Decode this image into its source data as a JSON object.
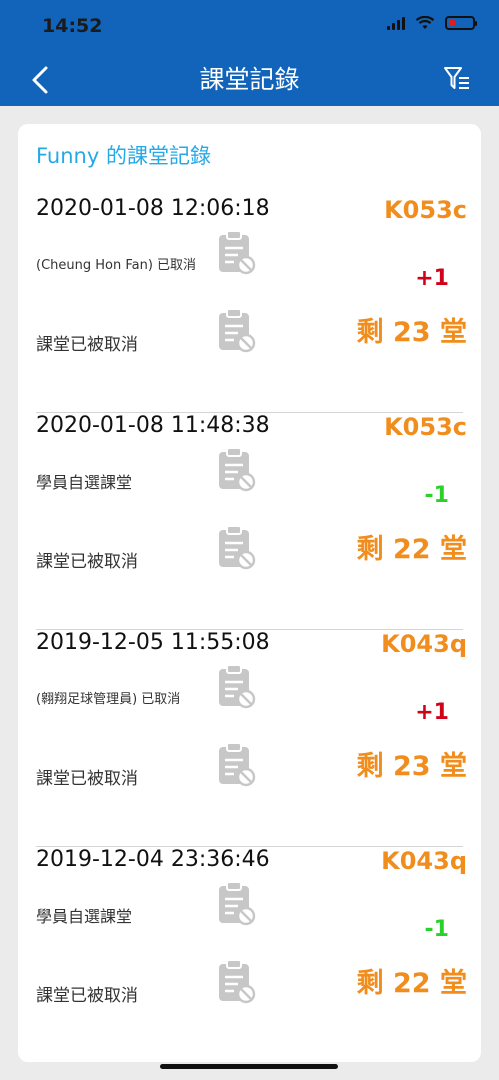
{
  "status_bar": {
    "time": "14:52"
  },
  "header": {
    "title": "課堂記錄"
  },
  "card": {
    "title": "Funny 的課堂記錄"
  },
  "records": [
    {
      "time": "2020-01-08 12:06:18",
      "code": "K053c",
      "desc": "(Cheung Hon Fan) 已取消",
      "change": "+1",
      "status": "課堂已被取消",
      "remaining": "剩 23 堂",
      "change_color": "#d0021b"
    },
    {
      "time": "2020-01-08 11:48:38",
      "code": "K053c",
      "desc": "學員自選課堂",
      "change": "-1",
      "status": "課堂已被取消",
      "remaining": "剩 22 堂",
      "change_color": "#2bd12b"
    },
    {
      "time": "2019-12-05 11:55:08",
      "code": "K043q",
      "desc": "(翱翔足球管理員) 已取消",
      "change": "+1",
      "status": "課堂已被取消",
      "remaining": "剩 23 堂",
      "change_color": "#d0021b"
    },
    {
      "time": "2019-12-04 23:36:46",
      "code": "K043q",
      "desc": "學員自選課堂",
      "change": "-1",
      "status": "課堂已被取消",
      "remaining": "剩 22 堂",
      "change_color": "#2bd12b"
    }
  ],
  "colors": {
    "header_bg": "#1164b9",
    "accent_orange": "#f08d1d",
    "title_blue": "#25a9e6",
    "plus_red": "#d0021b",
    "minus_green": "#2bd12b"
  },
  "icons": {
    "back": "chevron-left-icon",
    "filter": "filter-list-icon",
    "record": "clipboard-cancel-icon"
  }
}
